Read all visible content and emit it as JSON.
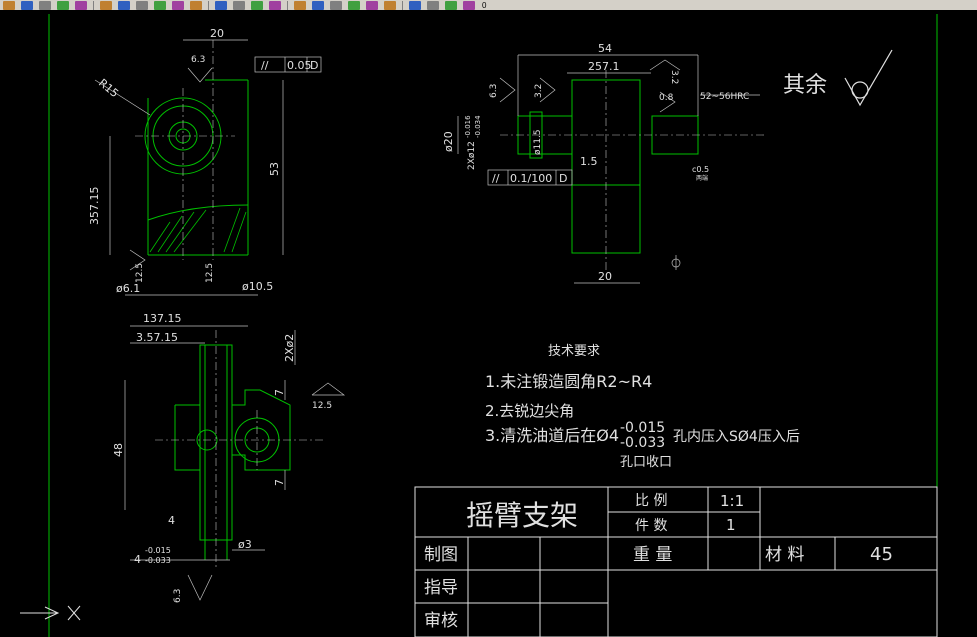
{
  "toolbar": {
    "icons": [
      "open-file",
      "save",
      "print",
      "preview",
      "spell",
      "cut",
      "copy",
      "paste",
      "match",
      "undo",
      "redo",
      "pan",
      "zoom-realtime",
      "zoom-window",
      "zoom-prev",
      "properties",
      "design-center",
      "tool-palette",
      "markup",
      "calculator",
      "help",
      "layers",
      "layer-state",
      "color",
      "layer-name"
    ],
    "layer_value": "0"
  },
  "drawing": {
    "title": "摇臂支架",
    "title_block": {
      "scale_label": "比  例",
      "scale_value": "1:1",
      "qty_label": "件  数",
      "qty_value": "1",
      "weight_label": "重  量",
      "material_label": "材  料",
      "material_value": "45",
      "drawn_label": "制图",
      "guide_label": "指导",
      "review_label": "审核"
    },
    "tech_requirements": {
      "heading": "技术要求",
      "line1": "1.未注锻造圆角R2~R4",
      "line2": "2.去锐边尖角",
      "line3_a": "3.清洗油道后在Ø4",
      "line3_tol_upper": "-0.015",
      "line3_tol_lower": "-0.033",
      "line3_b": "孔内压入SØ4压入后",
      "line4": "孔口收口"
    },
    "roughness_rest": "其余",
    "front_view": {
      "dim_top": "20",
      "dim_height": "53",
      "dim_left": "357.15",
      "radius": "R15",
      "rough_top": "6.3",
      "tol_symbol": "//",
      "tol_value": "0.05",
      "tol_datum": "D",
      "rough_bl": "12.5",
      "rough_bm": "12.5",
      "dim_bl": "ø6.1",
      "dim_br": "ø10.5"
    },
    "bottom_view": {
      "dim_top1": "137.15",
      "dim_top2": "3.57.15",
      "dim_2x": "2Xø2",
      "dim_height": "48",
      "dim_r1": "7",
      "dim_r2": "7",
      "dim_4": "4",
      "rough_right": "12.5",
      "tol_upper": "-0.015",
      "tol_lower": "-0.033",
      "dim_4b": "4",
      "dim_phi3": "ø3",
      "rough_bottom": "6.3"
    },
    "side_view": {
      "dim_top": "54",
      "dim_mid": "257.1",
      "rough_1": "6.3",
      "rough_2": "3.2",
      "rough_3": "3.2",
      "rough_4": "0.8",
      "hardness": "52~56HRC",
      "dim_phi20": "ø20",
      "dim_phi12": "2Xø12",
      "tol_up": "-0.016",
      "tol_lo": "-0.034",
      "dim_phi115": "ø11.5",
      "dim_15": "1.5",
      "chamfer": "c0.5",
      "chamfer_sub": "两端",
      "tol_symbol": "//",
      "tol_value": "0.1/100",
      "tol_datum": "D",
      "dim_bottom": "20"
    }
  }
}
